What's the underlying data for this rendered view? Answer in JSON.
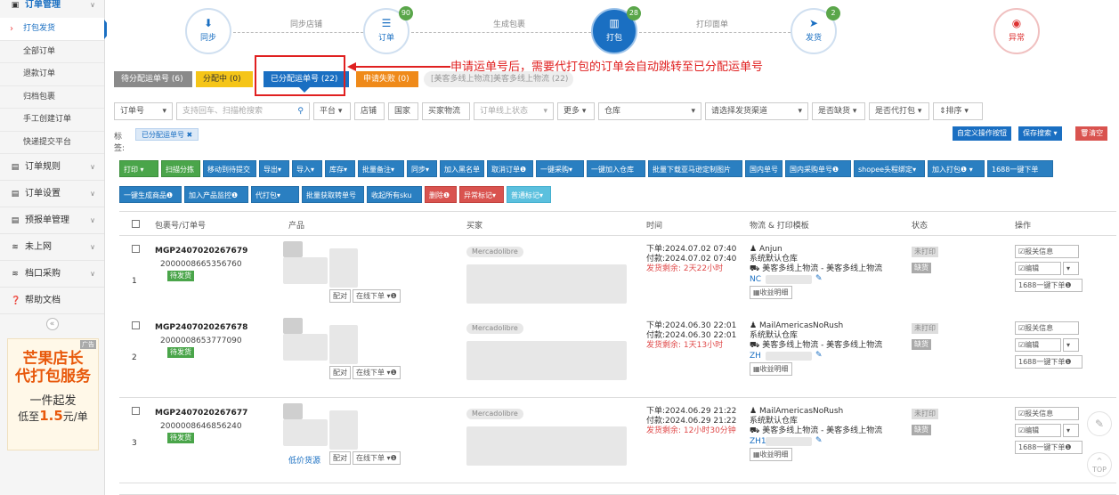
{
  "sidebar": {
    "top": {
      "label": "订单管理",
      "icon": "order-icon"
    },
    "items": [
      "打包发货",
      "全部订单",
      "退款订单",
      "归档包裹",
      "手工创建订单",
      "快递提交平台"
    ],
    "sections": [
      {
        "label": "订单规则",
        "icon": "rules-icon"
      },
      {
        "label": "订单设置",
        "icon": "settings-icon"
      },
      {
        "label": "预报单管理",
        "icon": "forecast-icon"
      },
      {
        "label": "未上网",
        "icon": "wifi-icon"
      },
      {
        "label": "档口采购",
        "icon": "wifi-icon"
      },
      {
        "label": "帮助文档",
        "icon": "help-icon"
      }
    ],
    "collapse": "«"
  },
  "ad": {
    "tag": "广告",
    "line1": "芒果店长",
    "line2": "代打包服务",
    "line3": "一件起发",
    "line4a": "低至",
    "line4b": "1.5",
    "line4c": "元/单"
  },
  "steps": [
    {
      "label": "同步",
      "icon": "download-icon",
      "badge": ""
    },
    {
      "label": "订单",
      "icon": "list-icon",
      "badge": "90"
    },
    {
      "label": "打包",
      "icon": "barcode-icon",
      "badge": "28"
    },
    {
      "label": "发货",
      "icon": "send-icon",
      "badge": "2"
    },
    {
      "label": "异常",
      "icon": "eye-off-icon",
      "badge": ""
    }
  ],
  "connectors": [
    "同步店铺",
    "生成包裹",
    "打印面单"
  ],
  "tabs": [
    "待分配运单号 (6)",
    "分配中 (0)",
    "已分配运单号 (22)",
    "申请失败 (0)",
    "[美客多线上物流]美客多线上物流 (22)"
  ],
  "annotation": "申请运单号后，需要代打包的订单会自动跳转至已分配运单号",
  "filters": {
    "order_no": "订单号",
    "search_ph": "支持回车、扫描枪搜索",
    "platform": "平台",
    "shop": "店铺",
    "country": "国家",
    "buyer_logistics": "买家物流",
    "order_status": "订单线上状态",
    "more": "更多",
    "warehouse": "仓库",
    "channel": "请选择发货渠道",
    "lack": "是否缺货",
    "agent": "是否代打包",
    "sort": "排序"
  },
  "tag_label": "标签:",
  "tag_chip": "已分配运单号",
  "right_buttons": [
    "自定义操作按钮",
    "保存搜索",
    "清空"
  ],
  "actions_row1": [
    "打印",
    "扫描分拣",
    "移动到待提交",
    "导出",
    "导入",
    "库存",
    "批量备注",
    "同步",
    "加入黑名单",
    "取消订单",
    "一键采购",
    "一键加入仓库",
    "批量下载亚马逊定制图片",
    "国内单号",
    "国内采购单号",
    "shopee头程绑定",
    "加入打包",
    "1688一键下单"
  ],
  "actions_row2": [
    "一键生成商品",
    "加入产品监控",
    "代打包",
    "批量获取转单号",
    "收起所有sku",
    "删除",
    "异常标记",
    "普通标记"
  ],
  "columns": [
    "包裹号/订单号",
    "产品",
    "买家",
    "时间",
    "物流 & 打印模板",
    "状态",
    "操作"
  ],
  "rows": [
    {
      "idx": "1",
      "pkg": "MGP2407020267679",
      "order": "2000008665356760",
      "status": "待发货",
      "platform": "Mercadolibre",
      "order_time": "下单:2024.07.02 07:40",
      "pay_time": "付款:2024.07.02 07:40",
      "remain": "发货剩余: 2天22小时",
      "carrier": "Anjun",
      "template": "系统默认仓库",
      "logistics": "美客多线上物流 - 美客多线上物流",
      "tracking": "NC",
      "profit": "收益明细",
      "print": "未打印",
      "stock": "缺货",
      "op1": "报关信息",
      "op2": "编辑",
      "op3": "1688一键下单",
      "pair": "配对",
      "online": "在线下单",
      "extra": ""
    },
    {
      "idx": "2",
      "pkg": "MGP2407020267678",
      "order": "2000008653777090",
      "status": "待发货",
      "platform": "Mercadolibre",
      "order_time": "下单:2024.06.30 22:01",
      "pay_time": "付款:2024.06.30 22:01",
      "remain": "发货剩余: 1天13小时",
      "carrier": "MailAmericasNoRush",
      "template": "系统默认仓库",
      "logistics": "美客多线上物流 - 美客多线上物流",
      "tracking": "ZH",
      "profit": "收益明细",
      "print": "未打印",
      "stock": "缺货",
      "op1": "报关信息",
      "op2": "编辑",
      "op3": "1688一键下单",
      "pair": "配对",
      "online": "在线下单",
      "extra": ""
    },
    {
      "idx": "3",
      "pkg": "MGP2407020267677",
      "order": "2000008646856240",
      "status": "待发货",
      "platform": "Mercadolibre",
      "order_time": "下单:2024.06.29 21:22",
      "pay_time": "付款:2024.06.29 21:22",
      "remain": "发货剩余: 12小时30分钟",
      "carrier": "MailAmericasNoRush",
      "template": "系统默认仓库",
      "logistics": "美客多线上物流 - 美客多线上物流",
      "tracking": "ZH1",
      "profit": "收益明细",
      "print": "未打印",
      "stock": "缺货",
      "op1": "报关信息",
      "op2": "编辑",
      "op3": "1688一键下单",
      "pair": "配对",
      "online": "在线下单",
      "extra": "低价货源"
    }
  ],
  "fab": {
    "top_label": "TOP"
  }
}
